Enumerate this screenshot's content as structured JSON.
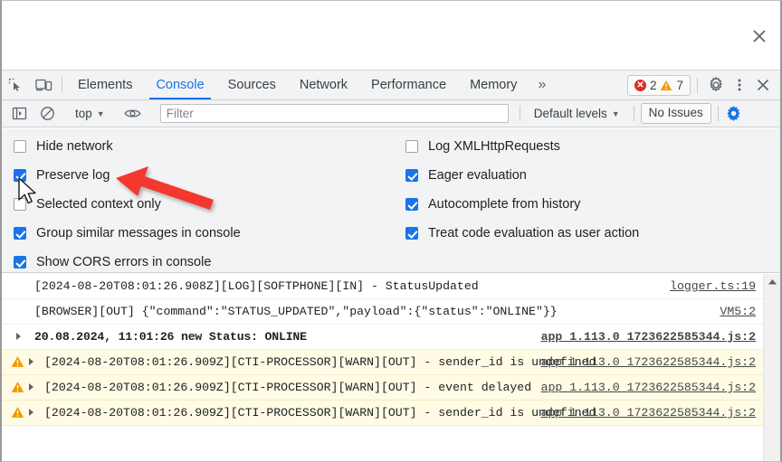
{
  "window": {
    "close_label": "×"
  },
  "tabbar": {
    "icons": [
      {
        "name": "inspect-element-icon"
      },
      {
        "name": "device-toolbar-icon"
      }
    ],
    "tabs": [
      {
        "label": "Elements",
        "active": false
      },
      {
        "label": "Console",
        "active": true
      },
      {
        "label": "Sources",
        "active": false
      },
      {
        "label": "Network",
        "active": false
      },
      {
        "label": "Performance",
        "active": false
      },
      {
        "label": "Memory",
        "active": false
      }
    ],
    "more_label": "»",
    "error_count": "2",
    "warning_count": "7",
    "settings_icon": "gear-icon",
    "more_options_icon": "kebab-menu-icon",
    "close_icon": "close-icon"
  },
  "console_toolbar": {
    "clear_icon": "sidebar-toggle-icon",
    "ban_icon": "clear-console-icon",
    "context_label": "top",
    "eye_icon": "live-expression-icon",
    "filter_placeholder": "Filter",
    "filter_value": "",
    "levels_label": "Default levels",
    "issues_label": "No Issues",
    "settings_icon": "console-settings-gear-icon"
  },
  "settings": {
    "left_column": [
      {
        "label": "Hide network",
        "checked": false
      },
      {
        "label": "Preserve log",
        "checked": true
      },
      {
        "label": "Selected context only",
        "checked": false
      },
      {
        "label": "Group similar messages in console",
        "checked": true
      },
      {
        "label": "Show CORS errors in console",
        "checked": true
      }
    ],
    "right_column": [
      {
        "label": "Log XMLHttpRequests",
        "checked": false
      },
      {
        "label": "Eager evaluation",
        "checked": true
      },
      {
        "label": "Autocomplete from history",
        "checked": true
      },
      {
        "label": "Treat code evaluation as user action",
        "checked": true
      }
    ]
  },
  "console_log": {
    "rows": [
      {
        "level": "log",
        "text": "[2024-08-20T08:01:26.908Z][LOG][SOFTPHONE][IN] - StatusUpdated",
        "source": "logger.ts:19",
        "has_disclosure": false,
        "bold": false
      },
      {
        "level": "log",
        "text": "[BROWSER][OUT] {\"command\":\"STATUS_UPDATED\",\"payload\":{\"status\":\"ONLINE\"}}",
        "source": "VM5:2",
        "has_disclosure": false,
        "bold": false
      },
      {
        "level": "log",
        "text": "20.08.2024, 11:01:26 new Status: ONLINE",
        "source": "app_1.113.0_1723622585344.js:2",
        "has_disclosure": true,
        "bold": true
      },
      {
        "level": "warn",
        "text": "[2024-08-20T08:01:26.909Z][CTI-PROCESSOR][WARN][OUT] - sender_id is undefined",
        "source": "app_1.113.0_1723622585344.js:2",
        "has_disclosure": true,
        "bold": false
      },
      {
        "level": "warn",
        "text": "[2024-08-20T08:01:26.909Z][CTI-PROCESSOR][WARN][OUT] - event delayed",
        "source": "app_1.113.0_1723622585344.js:2",
        "has_disclosure": true,
        "bold": false
      },
      {
        "level": "warn",
        "text": "[2024-08-20T08:01:26.909Z][CTI-PROCESSOR][WARN][OUT] - sender_id is undefined",
        "source": "app_1.113.0_1723622585344.js:2",
        "has_disclosure": true,
        "bold": false
      }
    ]
  },
  "annotation": {
    "arrow_color": "#f4382f",
    "arrow_points_at": "Preserve log",
    "cursor": "mouse-pointer"
  },
  "colors": {
    "accent": "#1a73e8",
    "error": "#d93025",
    "warning": "#f29900",
    "warn_row_bg": "#fffbe5",
    "panel_bg": "#f2f3f4"
  }
}
